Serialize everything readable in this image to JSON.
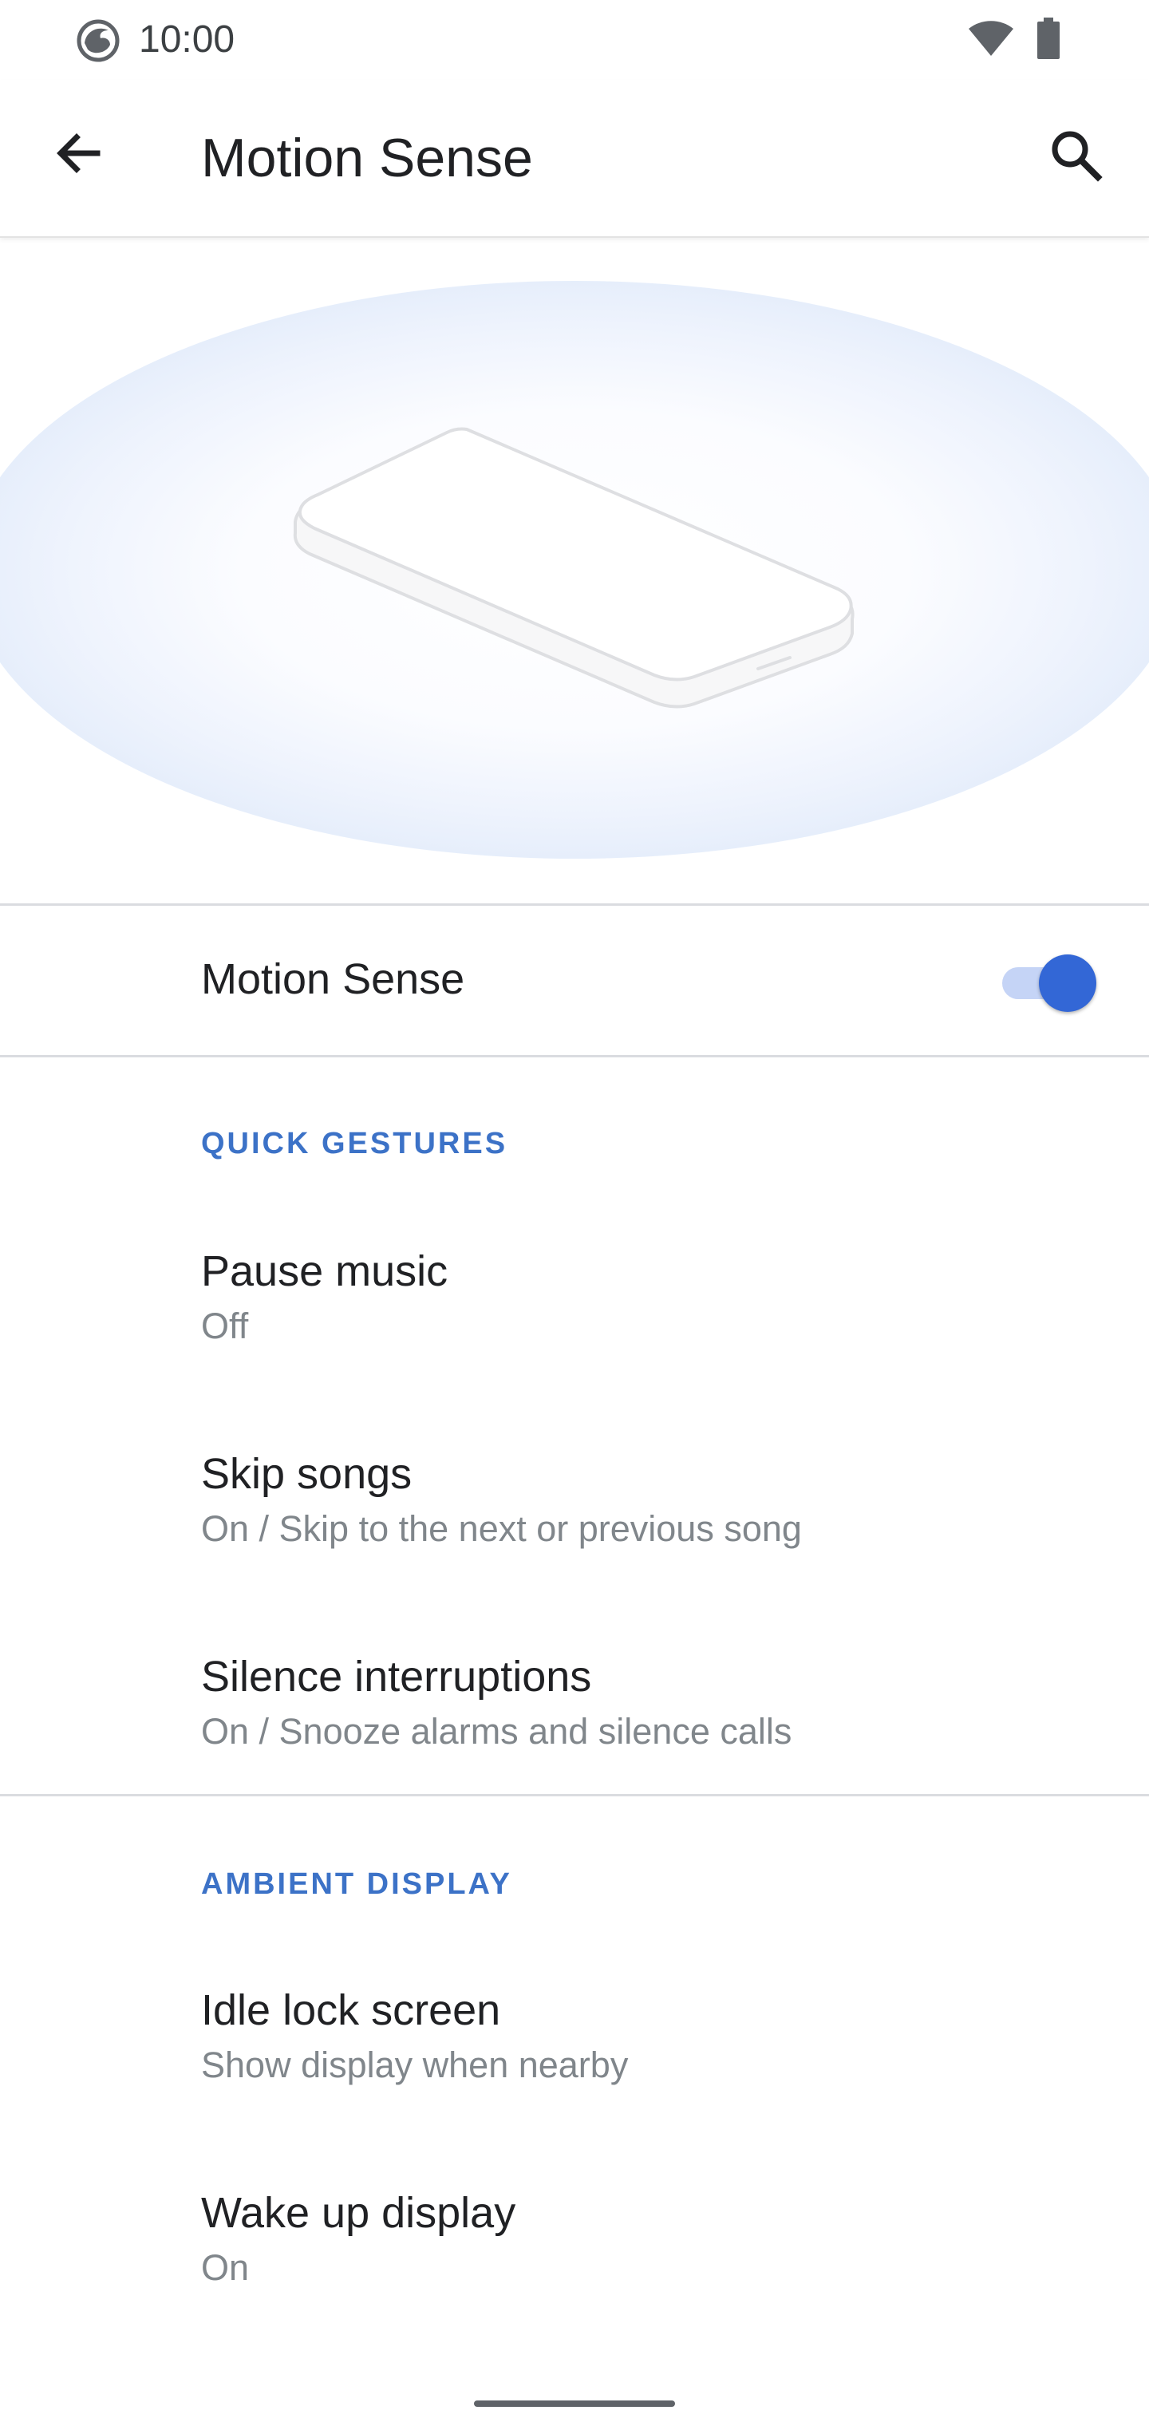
{
  "status_bar": {
    "time": "10:00",
    "app_icon": "firefox-icon",
    "wifi_icon": "wifi-icon",
    "battery_icon": "battery-icon"
  },
  "app_bar": {
    "title": "Motion Sense",
    "back_icon": "arrow-back-icon",
    "search_icon": "search-icon"
  },
  "master_toggle": {
    "label": "Motion Sense",
    "checked": true,
    "accent": "#3367d6"
  },
  "sections": [
    {
      "header": "QUICK GESTURES",
      "items": [
        {
          "title": "Pause music",
          "summary": "Off"
        },
        {
          "title": "Skip songs",
          "summary": "On / Skip to the next or previous song"
        },
        {
          "title": "Silence interruptions",
          "summary": "On / Snooze alarms and silence calls"
        }
      ]
    },
    {
      "header": "AMBIENT DISPLAY",
      "items": [
        {
          "title": "Idle lock screen",
          "summary": "Show display when nearby"
        },
        {
          "title": "Wake up display",
          "summary": "On"
        }
      ]
    }
  ],
  "colors": {
    "section_header": "#3c72c7",
    "summary_text": "#80868b",
    "divider": "#dadce0"
  }
}
